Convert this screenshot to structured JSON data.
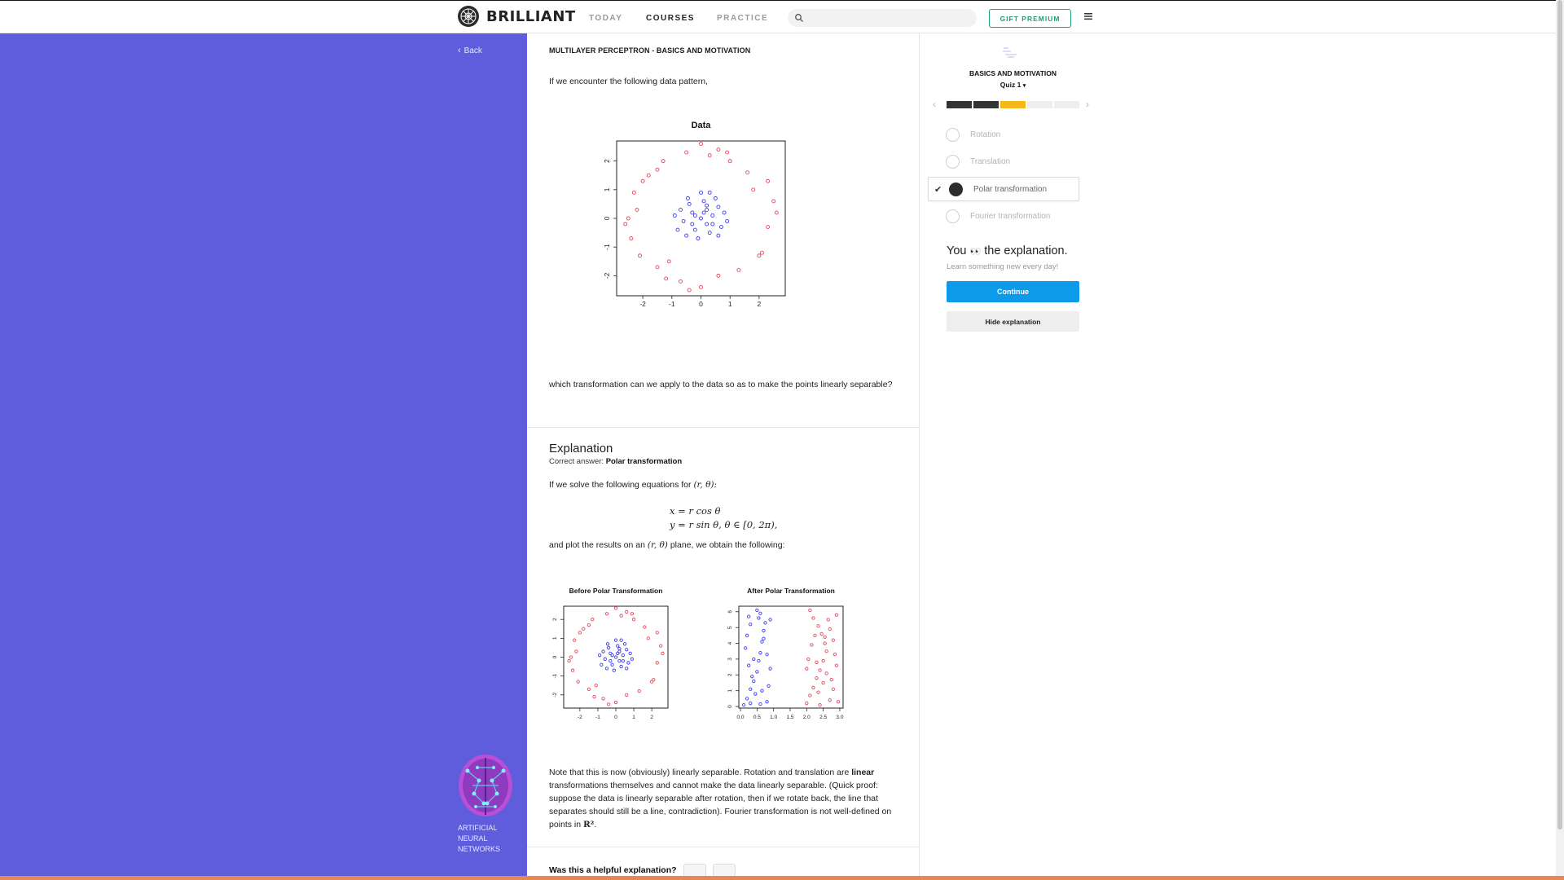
{
  "header": {
    "brand": "BRILLIANT",
    "nav": [
      "TODAY",
      "COURSES",
      "PRACTICE"
    ],
    "active_nav": "COURSES",
    "search_placeholder": "",
    "gift_label": "GIFT PREMIUM"
  },
  "sidebar": {
    "back_label": "Back",
    "course_lines": [
      "ARTIFICIAL",
      "NEURAL",
      "NETWORKS"
    ]
  },
  "problem": {
    "breadcrumb": "MULTILAYER PERCEPTRON - BASICS AND MOTIVATION",
    "intro": "If we encounter the following data pattern,",
    "question": "which transformation can we apply to the data so as to make the points linearly separable?"
  },
  "explanation": {
    "title": "Explanation",
    "correct_prefix": "Correct answer:",
    "correct_value": "Polar transformation",
    "solve_text": "If we solve the following equations for",
    "solve_math": "(r, θ):",
    "eq1": "x = r cos θ",
    "eq2": "y = r sin θ, θ ∈ [0, 2π),",
    "plot_text_a": "and plot the results on an",
    "plot_math": "(r, θ)",
    "plot_text_b": "plane, we obtain the following:",
    "note_a": "Note that this is now (obviously) linearly separable. Rotation and translation are ",
    "note_bold": "linear",
    "note_b": " transformations themselves and cannot make the data linearly separable. (Quick proof: suppose the data is linearly separable after rotation, then if we rotate back, the line that separates should still be a line, contradiction). Fourier transformation is not well-defined on points in ",
    "note_math": "R²",
    "note_end": ".",
    "helpful_question": "Was this a helpful explanation?"
  },
  "quiz": {
    "topic": "BASICS AND MOTIVATION",
    "name": "Quiz 1",
    "progress": {
      "total": 5,
      "done": 2,
      "current": 3
    },
    "options": [
      "Rotation",
      "Translation",
      "Polar transformation",
      "Fourier transformation"
    ],
    "selected_index": 2,
    "result_title_a": "You",
    "result_emoji": "👀",
    "result_title_b": "the explanation.",
    "result_sub": "Learn something new every day!",
    "continue_label": "Continue",
    "hide_label": "Hide explanation"
  },
  "colors": {
    "sidebar": "#5f5ddb",
    "red_points": "#e8455a",
    "blue_points": "#3a3af0",
    "accent_green": "#1aa37a",
    "continue_blue": "#0d9ae8",
    "progress_current": "#f5b819"
  },
  "chart_data": [
    {
      "type": "scatter",
      "title": "Data",
      "xlim": [
        -2.9,
        2.9
      ],
      "ylim": [
        -2.7,
        2.7
      ],
      "x_ticks": [
        "-2",
        "-1",
        "0",
        "1",
        "2"
      ],
      "y_ticks": [
        "-2",
        "-1",
        "0",
        "1",
        "2"
      ],
      "series": [
        {
          "color": "#e8455a",
          "points": [
            [
              -2.5,
              0
            ],
            [
              -2.4,
              -0.7
            ],
            [
              -2.3,
              0.9
            ],
            [
              -2.1,
              -1.3
            ],
            [
              -1.8,
              1.5
            ],
            [
              -1.5,
              -1.7
            ],
            [
              -1.2,
              -2.1
            ],
            [
              -0.7,
              -2.2
            ],
            [
              0,
              -2.4
            ],
            [
              0.6,
              -2.0
            ],
            [
              1.3,
              -1.8
            ],
            [
              2.1,
              -1.2
            ],
            [
              2.3,
              -0.3
            ],
            [
              2.5,
              0.6
            ],
            [
              2.3,
              1.3
            ],
            [
              1.6,
              1.6
            ],
            [
              1.0,
              2.0
            ],
            [
              0.6,
              2.4
            ],
            [
              -0.5,
              2.3
            ],
            [
              0,
              2.6
            ],
            [
              -1.5,
              1.7
            ],
            [
              -2.0,
              1.3
            ],
            [
              -2.2,
              0.3
            ],
            [
              2.0,
              -1.3
            ],
            [
              -1.3,
              2.0
            ],
            [
              0.9,
              2.3
            ],
            [
              -1.1,
              -1.5
            ],
            [
              2.6,
              0.2
            ],
            [
              -2.6,
              -0.2
            ],
            [
              -0.4,
              -2.5
            ],
            [
              0.3,
              2.2
            ],
            [
              1.8,
              1.0
            ]
          ]
        },
        {
          "color": "#3a3af0",
          "points": [
            [
              0,
              0
            ],
            [
              0.2,
              0.3
            ],
            [
              -0.3,
              0.2
            ],
            [
              0.4,
              -0.2
            ],
            [
              -0.2,
              -0.4
            ],
            [
              0.6,
              0.4
            ],
            [
              -0.6,
              -0.1
            ],
            [
              0.1,
              0.6
            ],
            [
              0.3,
              -0.5
            ],
            [
              -0.4,
              0.5
            ],
            [
              0.7,
              -0.3
            ],
            [
              -0.7,
              0.3
            ],
            [
              0.5,
              0.7
            ],
            [
              -0.1,
              -0.7
            ],
            [
              0.8,
              0.2
            ],
            [
              -0.8,
              -0.4
            ],
            [
              0.2,
              -0.2
            ],
            [
              -0.2,
              0.1
            ],
            [
              0.1,
              0.2
            ],
            [
              0.4,
              0.1
            ],
            [
              -0.5,
              -0.6
            ],
            [
              0.6,
              -0.6
            ],
            [
              0,
              0.9
            ],
            [
              -0.3,
              -0.2
            ],
            [
              0.3,
              0.9
            ],
            [
              0.9,
              -0.1
            ],
            [
              -0.9,
              0.1
            ],
            [
              0.2,
              0.45
            ],
            [
              -0.45,
              0.7
            ]
          ]
        }
      ]
    },
    {
      "type": "scatter",
      "title": "Before Polar Transformation",
      "xlim": [
        -2.9,
        2.9
      ],
      "ylim": [
        -2.7,
        2.7
      ],
      "x_ticks": [
        "-2",
        "-1",
        "0",
        "1",
        "2"
      ],
      "y_ticks": [
        "-2",
        "-1",
        "0",
        "1",
        "2"
      ],
      "series": [
        {
          "color": "#e8455a",
          "points": [
            [
              -2.5,
              0
            ],
            [
              -2.4,
              -0.7
            ],
            [
              -2.3,
              0.9
            ],
            [
              -2.1,
              -1.3
            ],
            [
              -1.8,
              1.5
            ],
            [
              -1.5,
              -1.7
            ],
            [
              -1.2,
              -2.1
            ],
            [
              -0.7,
              -2.2
            ],
            [
              0,
              -2.4
            ],
            [
              0.6,
              -2.0
            ],
            [
              1.3,
              -1.8
            ],
            [
              2.1,
              -1.2
            ],
            [
              2.3,
              -0.3
            ],
            [
              2.5,
              0.6
            ],
            [
              2.3,
              1.3
            ],
            [
              1.6,
              1.6
            ],
            [
              1.0,
              2.0
            ],
            [
              0.6,
              2.4
            ],
            [
              -0.5,
              2.3
            ],
            [
              0,
              2.6
            ],
            [
              -1.5,
              1.7
            ],
            [
              -2.0,
              1.3
            ],
            [
              -2.2,
              0.3
            ],
            [
              2.0,
              -1.3
            ],
            [
              -1.3,
              2.0
            ],
            [
              0.9,
              2.3
            ],
            [
              -1.1,
              -1.5
            ],
            [
              2.6,
              0.2
            ],
            [
              -2.6,
              -0.2
            ],
            [
              -0.4,
              -2.5
            ],
            [
              0.3,
              2.2
            ],
            [
              1.8,
              1.0
            ]
          ]
        },
        {
          "color": "#3a3af0",
          "points": [
            [
              0,
              0
            ],
            [
              0.2,
              0.3
            ],
            [
              -0.3,
              0.2
            ],
            [
              0.4,
              -0.2
            ],
            [
              -0.2,
              -0.4
            ],
            [
              0.6,
              0.4
            ],
            [
              -0.6,
              -0.1
            ],
            [
              0.1,
              0.6
            ],
            [
              0.3,
              -0.5
            ],
            [
              -0.4,
              0.5
            ],
            [
              0.7,
              -0.3
            ],
            [
              -0.7,
              0.3
            ],
            [
              0.5,
              0.7
            ],
            [
              -0.1,
              -0.7
            ],
            [
              0.8,
              0.2
            ],
            [
              -0.8,
              -0.4
            ],
            [
              0.2,
              -0.2
            ],
            [
              -0.2,
              0.1
            ],
            [
              0.1,
              0.2
            ],
            [
              0.4,
              0.1
            ],
            [
              -0.5,
              -0.6
            ],
            [
              0.6,
              -0.6
            ],
            [
              0,
              0.9
            ],
            [
              -0.3,
              -0.2
            ],
            [
              0.3,
              0.9
            ],
            [
              0.9,
              -0.1
            ],
            [
              -0.9,
              0.1
            ],
            [
              0.2,
              0.45
            ],
            [
              -0.45,
              0.7
            ]
          ]
        }
      ]
    },
    {
      "type": "scatter",
      "title": "After Polar Transformation",
      "xlim": [
        -0.05,
        3.1
      ],
      "ylim": [
        -0.1,
        6.35
      ],
      "x_ticks": [
        "0.0",
        "0.5",
        "1.0",
        "1.5",
        "2.0",
        "2.5",
        "3.0"
      ],
      "y_ticks": [
        "0",
        "1",
        "2",
        "3",
        "4",
        "5",
        "6"
      ],
      "series": [
        {
          "color": "#3a3af0",
          "points": [
            [
              0.1,
              0.1
            ],
            [
              0.2,
              0.5
            ],
            [
              0.3,
              1.1
            ],
            [
              0.4,
              1.6
            ],
            [
              0.5,
              2.2
            ],
            [
              0.55,
              2.9
            ],
            [
              0.6,
              3.4
            ],
            [
              0.65,
              4.1
            ],
            [
              0.7,
              4.8
            ],
            [
              0.75,
              5.3
            ],
            [
              0.6,
              5.9
            ],
            [
              0.5,
              6.1
            ],
            [
              0.3,
              5.2
            ],
            [
              0.2,
              4.5
            ],
            [
              0.15,
              3.7
            ],
            [
              0.25,
              2.6
            ],
            [
              0.35,
              1.9
            ],
            [
              0.45,
              0.8
            ],
            [
              0.8,
              0.3
            ],
            [
              0.85,
              1.3
            ],
            [
              0.9,
              2.4
            ],
            [
              0.8,
              3.3
            ],
            [
              0.7,
              4.3
            ],
            [
              0.9,
              5.5
            ],
            [
              0.4,
              3.0
            ],
            [
              0.3,
              0.2
            ],
            [
              0.6,
              0.15
            ],
            [
              0.55,
              5.6
            ],
            [
              0.25,
              5.7
            ],
            [
              0.65,
              1.0
            ]
          ]
        },
        {
          "color": "#e8455a",
          "points": [
            [
              2.0,
              0.2
            ],
            [
              2.1,
              0.7
            ],
            [
              2.2,
              1.2
            ],
            [
              2.3,
              1.8
            ],
            [
              2.4,
              2.3
            ],
            [
              2.5,
              2.9
            ],
            [
              2.6,
              3.5
            ],
            [
              2.55,
              4.0
            ],
            [
              2.45,
              4.6
            ],
            [
              2.35,
              5.1
            ],
            [
              2.2,
              5.6
            ],
            [
              2.1,
              6.1
            ],
            [
              2.7,
              0.4
            ],
            [
              2.8,
              1.1
            ],
            [
              2.75,
              1.7
            ],
            [
              2.9,
              2.6
            ],
            [
              2.85,
              3.3
            ],
            [
              2.8,
              4.2
            ],
            [
              2.7,
              4.9
            ],
            [
              2.9,
              5.8
            ],
            [
              2.05,
              3.0
            ],
            [
              2.15,
              3.9
            ],
            [
              2.25,
              4.5
            ],
            [
              2.35,
              0.9
            ],
            [
              2.5,
              1.5
            ],
            [
              2.6,
              2.1
            ],
            [
              2.4,
              0.1
            ],
            [
              2.65,
              5.5
            ],
            [
              2.0,
              2.4
            ],
            [
              2.95,
              0.3
            ],
            [
              2.3,
              2.8
            ],
            [
              2.55,
              4.4
            ]
          ]
        }
      ]
    }
  ]
}
